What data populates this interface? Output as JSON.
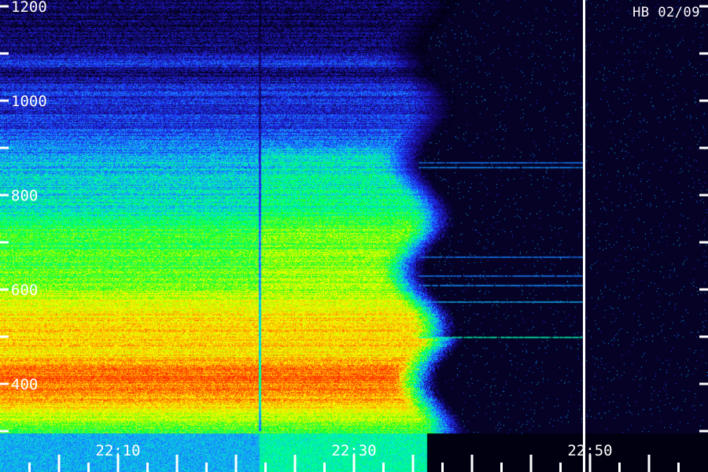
{
  "station_label": "HB 02/09",
  "chart_data": {
    "type": "heatmap",
    "title": "",
    "xlabel": "",
    "ylabel": "",
    "colormap": [
      "#000010",
      "#1a0a8c",
      "#1e32ff",
      "#14a0ff",
      "#00ffb4",
      "#00ff28",
      "#b4ff00",
      "#ffff00",
      "#ffa000",
      "#ff2800"
    ],
    "x_axis": {
      "unit": "time",
      "range": [
        "22:03",
        "22:56"
      ],
      "ticks": [
        {
          "value": "22:10",
          "label": "22:10"
        },
        {
          "value": "22:30",
          "label": "22:30"
        },
        {
          "value": "22:50",
          "label": "22:50"
        }
      ],
      "minor_tick_interval_minutes": 5
    },
    "y_axis": {
      "unit": "Hz",
      "range": [
        280,
        1200
      ],
      "ticks": [
        {
          "value": 400,
          "label": "400"
        },
        {
          "value": 600,
          "label": "600"
        },
        {
          "value": 800,
          "label": "800"
        },
        {
          "value": 1000,
          "label": "1000"
        },
        {
          "value": 1200,
          "label": "1200"
        }
      ],
      "minor_tick_interval": 100
    },
    "cursor_line_time": "22:49.5",
    "data_gap_time": "22:22",
    "emission_end_time": "22:35.5",
    "intensity_profile_hz": [
      {
        "freq": 300,
        "level": 0.55
      },
      {
        "freq": 330,
        "level": 0.7
      },
      {
        "freq": 380,
        "level": 0.92
      },
      {
        "freq": 420,
        "level": 0.95
      },
      {
        "freq": 470,
        "level": 0.8
      },
      {
        "freq": 520,
        "level": 0.82
      },
      {
        "freq": 560,
        "level": 0.78
      },
      {
        "freq": 620,
        "level": 0.62
      },
      {
        "freq": 660,
        "level": 0.58
      },
      {
        "freq": 720,
        "level": 0.56
      },
      {
        "freq": 780,
        "level": 0.42
      },
      {
        "freq": 830,
        "level": 0.38
      },
      {
        "freq": 880,
        "level": 0.35
      },
      {
        "freq": 930,
        "level": 0.25
      },
      {
        "freq": 980,
        "level": 0.18
      },
      {
        "freq": 1030,
        "level": 0.2
      },
      {
        "freq": 1060,
        "level": 0.05
      },
      {
        "freq": 1080,
        "level": 0.22
      },
      {
        "freq": 1100,
        "level": 0.12
      },
      {
        "freq": 1150,
        "level": 0.06
      },
      {
        "freq": 1200,
        "level": 0.05
      }
    ],
    "discrete_lines_hz": [
      {
        "freq": 500,
        "start": "22:35.5",
        "end": "22:49.5",
        "level": 0.45
      },
      {
        "freq": 575,
        "start": "22:35.5",
        "end": "22:49.5",
        "level": 0.35
      },
      {
        "freq": 610,
        "start": "22:35.5",
        "end": "22:49.5",
        "level": 0.32
      },
      {
        "freq": 630,
        "start": "22:35.5",
        "end": "22:49.5",
        "level": 0.3
      },
      {
        "freq": 670,
        "start": "22:35.5",
        "end": "22:49.5",
        "level": 0.3
      },
      {
        "freq": 860,
        "start": "22:35.5",
        "end": "22:49.5",
        "level": 0.32
      },
      {
        "freq": 870,
        "start": "22:35.5",
        "end": "22:49.5",
        "level": 0.3
      }
    ]
  }
}
